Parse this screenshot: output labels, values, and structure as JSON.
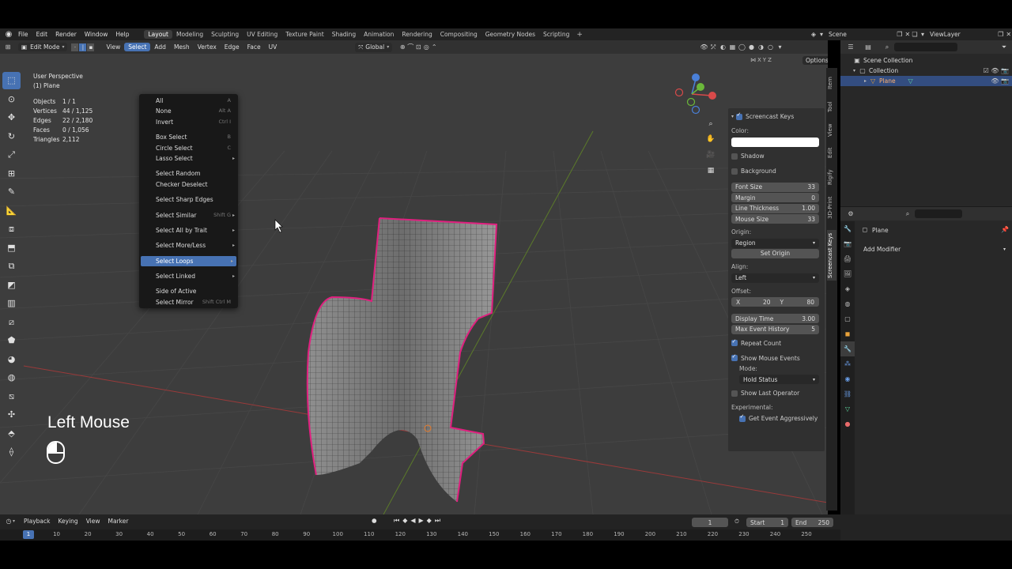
{
  "menubar": {
    "items": [
      "File",
      "Edit",
      "Render",
      "Window",
      "Help"
    ],
    "workspaces": [
      "Layout",
      "Modeling",
      "Sculpting",
      "UV Editing",
      "Texture Paint",
      "Shading",
      "Animation",
      "Rendering",
      "Compositing",
      "Geometry Nodes",
      "Scripting"
    ],
    "active_workspace": "Layout",
    "add_workspace": "+",
    "scene": "Scene",
    "view_layer": "ViewLayer"
  },
  "viewport_header": {
    "mode": "Edit Mode",
    "menus": [
      "View",
      "Select",
      "Add",
      "Mesh",
      "Vertex",
      "Edge",
      "Face",
      "UV"
    ],
    "active_menu": "Select",
    "orientation": "Global",
    "options": "Options"
  },
  "viewport_info": {
    "perspective": "User Perspective",
    "object": "(1) Plane",
    "stats": [
      {
        "k": "Objects",
        "v": "1 / 1"
      },
      {
        "k": "Vertices",
        "v": "44 / 1,125"
      },
      {
        "k": "Edges",
        "v": "22 / 2,180"
      },
      {
        "k": "Faces",
        "v": "0 / 1,056"
      },
      {
        "k": "Triangles",
        "v": "2,112"
      }
    ]
  },
  "select_menu": {
    "items": [
      {
        "label": "All",
        "shortcut": "A"
      },
      {
        "label": "None",
        "shortcut": "Alt A"
      },
      {
        "label": "Invert",
        "shortcut": "Ctrl I"
      },
      {
        "gap": true
      },
      {
        "label": "Box Select",
        "shortcut": "B"
      },
      {
        "label": "Circle Select",
        "shortcut": "C"
      },
      {
        "label": "Lasso Select",
        "submenu": true
      },
      {
        "gap": true
      },
      {
        "label": "Select Random"
      },
      {
        "label": "Checker Deselect"
      },
      {
        "gap": true
      },
      {
        "label": "Select Sharp Edges"
      },
      {
        "gap": true
      },
      {
        "label": "Select Similar",
        "shortcut": "Shift G",
        "submenu": true
      },
      {
        "gap": true
      },
      {
        "label": "Select All by Trait",
        "submenu": true
      },
      {
        "gap": true
      },
      {
        "label": "Select More/Less",
        "submenu": true
      },
      {
        "gap": true
      },
      {
        "label": "Select Loops",
        "submenu": true,
        "active": true
      },
      {
        "gap": true
      },
      {
        "label": "Select Linked",
        "submenu": true
      },
      {
        "gap": true
      },
      {
        "label": "Side of Active"
      },
      {
        "label": "Select Mirror",
        "shortcut": "Shift Ctrl M"
      }
    ]
  },
  "screencast_overlay": {
    "text": "Left Mouse",
    "icon": "mouse-left-icon"
  },
  "npanel": {
    "title": "Screencast Keys",
    "color_label": "Color:",
    "shadow": "Shadow",
    "background": "Background",
    "font_size": {
      "label": "Font Size",
      "value": "33"
    },
    "margin": {
      "label": "Margin",
      "value": "0"
    },
    "line_thickness": {
      "label": "Line Thickness",
      "value": "1.00"
    },
    "mouse_size": {
      "label": "Mouse Size",
      "value": "33"
    },
    "origin_label": "Origin:",
    "origin_value": "Region",
    "set_origin": "Set Origin",
    "align_label": "Align:",
    "align_value": "Left",
    "offset_label": "Offset:",
    "offset_x_label": "X",
    "offset_x": "20",
    "offset_y_label": "Y",
    "offset_y": "80",
    "display_time": {
      "label": "Display Time",
      "value": "3.00"
    },
    "max_history": {
      "label": "Max Event History",
      "value": "5"
    },
    "repeat_count": "Repeat Count",
    "show_mouse_events": "Show Mouse Events",
    "mode_label": "Mode:",
    "mode_value": "Hold Status",
    "show_last_operator": "Show Last Operator",
    "experimental_label": "Experimental:",
    "get_event": "Get Event Aggressively",
    "tabs": [
      "Item",
      "Tool",
      "View",
      "Edit",
      "Rigify",
      "3D-Print",
      "Screencast Keys"
    ]
  },
  "outliner": {
    "root": "Scene Collection",
    "collection": "Collection",
    "object": "Plane"
  },
  "properties": {
    "object_name": "Plane",
    "add_modifier": "Add Modifier"
  },
  "timeline": {
    "menus": [
      "Playback",
      "Keying",
      "View",
      "Marker"
    ],
    "current_frame": "1",
    "start_label": "Start",
    "start": "1",
    "end_label": "End",
    "end": "250",
    "ticks": [
      "1",
      "10",
      "20",
      "30",
      "40",
      "50",
      "60",
      "70",
      "80",
      "90",
      "100",
      "110",
      "120",
      "130",
      "140",
      "150",
      "160",
      "170",
      "180",
      "190",
      "200",
      "210",
      "220",
      "230",
      "240",
      "250"
    ]
  },
  "colors": {
    "accent": "#4772b3",
    "selected_edge": "#e0207f",
    "viewport_bg": "#3d3d3d"
  }
}
